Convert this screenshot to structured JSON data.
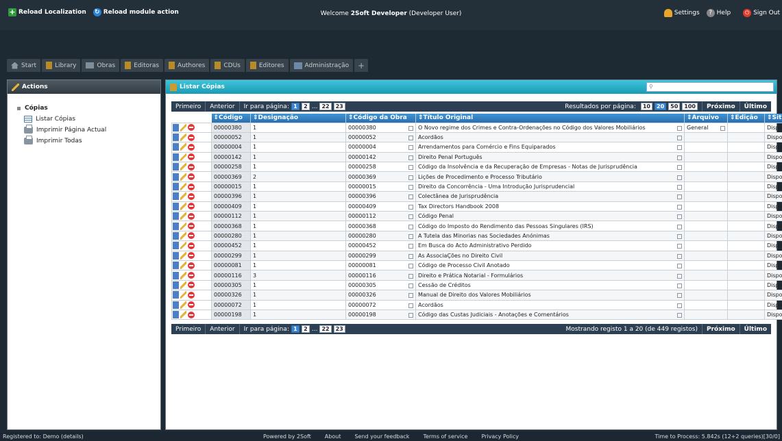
{
  "topbar": {
    "reload_localization": "Reload Localization",
    "reload_module": "Reload module action",
    "welcome_prefix": "Welcome",
    "user_name": "2Soft Developer",
    "user_role": "(Developer User)",
    "settings": "Settings",
    "help": "Help",
    "signout": "Sign Out"
  },
  "nav": {
    "tabs": [
      "Start",
      "Library",
      "Obras",
      "Editoras",
      "Authores",
      "CDUs",
      "Editores",
      "Administração"
    ],
    "add": "+"
  },
  "sidebar": {
    "header": "Actions",
    "root": "Cópias",
    "items": [
      "Listar Cópias",
      "Imprimir Página Actual",
      "Imprimir Todas"
    ]
  },
  "main": {
    "header": "Listar Cópias",
    "pager_top": {
      "first": "Primeiro",
      "prev": "Anterior",
      "goto": "Ir para página:",
      "pages": [
        "1",
        "2",
        "...",
        "22",
        "23"
      ],
      "results_label": "Resultados por página:",
      "sizes": [
        "10",
        "20",
        "50",
        "100"
      ],
      "next": "Próximo",
      "last": "Último"
    },
    "pager_bottom": {
      "first": "Primeiro",
      "prev": "Anterior",
      "goto": "Ir para página:",
      "pages": [
        "1",
        "2",
        "...",
        "22",
        "23"
      ],
      "status": "Mostrando registo 1 a 20 (de 449 registos)",
      "next": "Próximo",
      "last": "Último"
    },
    "columns": [
      "Código",
      "Designação",
      "Código da Obra",
      "Título Original",
      "Arquivo",
      "Edição",
      "Situação"
    ],
    "rows": [
      [
        "00000380",
        "1",
        "00000380",
        "O Novo regime dos Crimes e Contra-Ordenações no Código dos Valores Mobiliários",
        "General",
        "",
        "Disponível"
      ],
      [
        "00000052",
        "1",
        "00000052",
        "Acordãos",
        "",
        "",
        "Disponível"
      ],
      [
        "00000004",
        "1",
        "00000004",
        "Arrendamentos para Comércio e Fins Equiparados",
        "",
        "",
        "Disponível"
      ],
      [
        "00000142",
        "1",
        "00000142",
        "Direito Penal Português",
        "",
        "",
        "Disponível"
      ],
      [
        "00000258",
        "1",
        "00000258",
        "Código da Insolvência e da Recuperação de Empresas - Notas de Jurisprudência",
        "",
        "",
        "Disponível"
      ],
      [
        "00000369",
        "2",
        "00000369",
        "Lições de Procedimento e Processo Tributário",
        "",
        "",
        "Disponível"
      ],
      [
        "00000015",
        "1",
        "00000015",
        "Direito da Concorrência - Uma Introdução Jurisprudencial",
        "",
        "",
        "Disponível"
      ],
      [
        "00000396",
        "1",
        "00000396",
        "Colectânea de Jurisprudência",
        "",
        "",
        "Disponível"
      ],
      [
        "00000409",
        "1",
        "00000409",
        "Tax Directors Handbook 2008",
        "",
        "",
        "Disponível"
      ],
      [
        "00000112",
        "1",
        "00000112",
        "Código Penal",
        "",
        "",
        "Disponível"
      ],
      [
        "00000368",
        "1",
        "00000368",
        "Código do Imposto do Rendimento das Pessoas Singulares (IRS)",
        "",
        "",
        "Disponível"
      ],
      [
        "00000280",
        "1",
        "00000280",
        "A Tutela das Minorias nas Sociedades Anónimas",
        "",
        "",
        "Disponível"
      ],
      [
        "00000452",
        "1",
        "00000452",
        "Em Busca do Acto Administrativo Perdido",
        "",
        "",
        "Disponível"
      ],
      [
        "00000299",
        "1",
        "00000299",
        "As AssociaÇões no Direito Civil",
        "",
        "",
        "Disponível"
      ],
      [
        "00000081",
        "1",
        "00000081",
        "Código de Processo Civil Anotado",
        "",
        "",
        "Disponível"
      ],
      [
        "00000116",
        "3",
        "00000116",
        "Direito e Prática Notarial - Formulários",
        "",
        "",
        "Disponível"
      ],
      [
        "00000305",
        "1",
        "00000305",
        "Cessão de Créditos",
        "",
        "",
        "Disponível"
      ],
      [
        "00000326",
        "1",
        "00000326",
        "Manual de Direito dos Valores Mobiliários",
        "",
        "",
        "Disponível"
      ],
      [
        "00000072",
        "1",
        "00000072",
        "Acordãos",
        "",
        "",
        "Disponível"
      ],
      [
        "00000198",
        "1",
        "00000198",
        "Código das Custas Judiciais - Anotações e Comentários",
        "",
        "",
        "Disponível"
      ]
    ]
  },
  "footer": {
    "registered": "Registered to: Demo (details)",
    "links": [
      "Powered by 2Soft",
      "About",
      "Send your feedback",
      "Terms of service",
      "Privacy Policy"
    ],
    "timing": "Time to Process: 5.842s (12+2 queries)[30/0]"
  }
}
